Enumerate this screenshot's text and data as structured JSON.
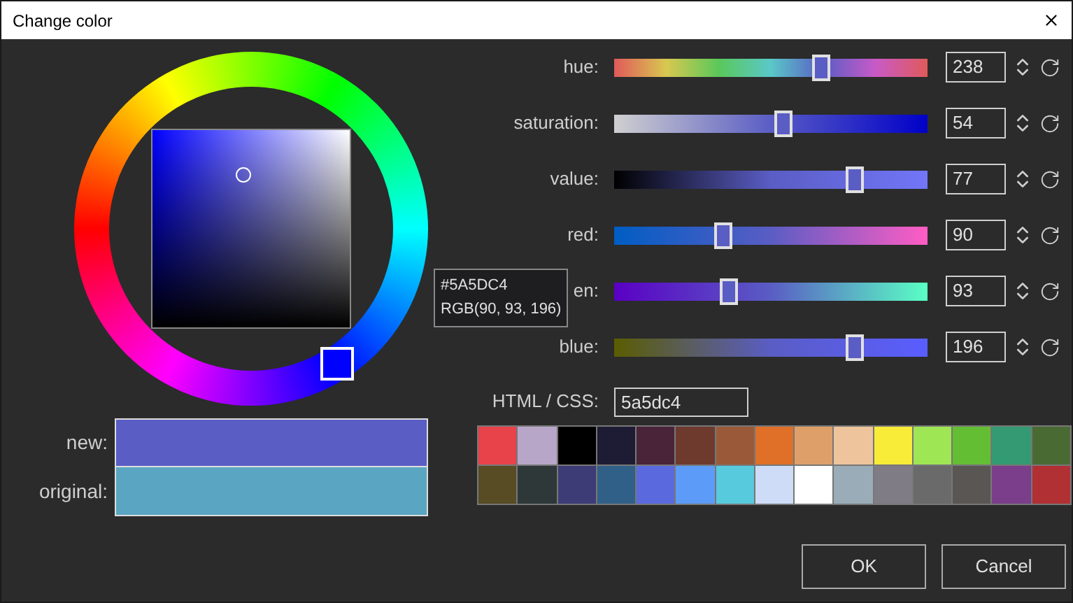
{
  "window": {
    "title": "Change color"
  },
  "swatches": [
    {
      "label": "new:",
      "color": "#5a5dc4"
    },
    {
      "label": "original:",
      "color": "#5aa6c2"
    }
  ],
  "tooltip": {
    "hex": "#5A5DC4",
    "rgb": "RGB(90, 93, 196)"
  },
  "sliders": [
    {
      "kind": "hue",
      "label": "hue:",
      "level": 0.66,
      "value": "238"
    },
    {
      "kind": "saturation",
      "label": "saturation:",
      "level": 0.54,
      "value": "54"
    },
    {
      "kind": "value",
      "label": "value:",
      "level": 0.77,
      "value": "77"
    },
    {
      "kind": "red",
      "label": "red:",
      "level": 0.35,
      "value": "90"
    },
    {
      "kind": "green",
      "label": "en:",
      "level": 0.365,
      "value": "93"
    },
    {
      "kind": "blue",
      "label": "blue:",
      "level": 0.77,
      "value": "196"
    }
  ],
  "html_css": {
    "label": "HTML / CSS:",
    "value": "5a5dc4"
  },
  "palette": [
    {
      "color": "#e8424a"
    },
    {
      "color": "#b8a6c8"
    },
    {
      "color": "#000000"
    },
    {
      "color": "#1e1c34"
    },
    {
      "color": "#4a2438"
    },
    {
      "color": "#6e3a2e"
    },
    {
      "color": "#9a5a3a"
    },
    {
      "color": "#e07028"
    },
    {
      "color": "#dea068"
    },
    {
      "color": "#eec49c"
    },
    {
      "color": "#f8ec38"
    },
    {
      "color": "#9ee654"
    },
    {
      "color": "#64be34"
    },
    {
      "color": "#349a74"
    },
    {
      "color": "#4a6a34"
    },
    {
      "color": "#584c24"
    },
    {
      "color": "#2e3838"
    },
    {
      "color": "#3e3c76"
    },
    {
      "color": "#306088"
    },
    {
      "color": "#5a6ade"
    },
    {
      "color": "#5c9cf8"
    },
    {
      "color": "#58cade"
    },
    {
      "color": "#cedcf8"
    },
    {
      "color": "#ffffff"
    },
    {
      "color": "#9aacb8"
    },
    {
      "color": "#807c86"
    },
    {
      "color": "#6a6a6a"
    },
    {
      "color": "#5a5654"
    },
    {
      "color": "#7a3e8a"
    },
    {
      "color": "#b03034"
    }
  ],
  "buttons": [
    "OK",
    "Cancel"
  ]
}
